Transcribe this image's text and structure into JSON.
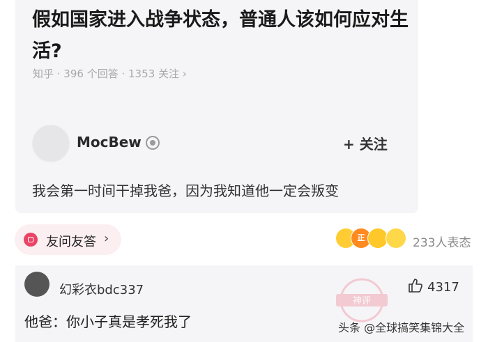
{
  "question": {
    "title": "假如国家进入战争状态，普通人该如何应对生活?",
    "meta": "知乎 · 396 个回答 · 1353 关注 ›"
  },
  "answer": {
    "username": "MocBew",
    "follow_label": "+ 关注",
    "text": "我会第一时间干掉我爸，因为我知道他一定会叛变"
  },
  "ask_friend": {
    "label": "友问友答",
    "chevron": "›"
  },
  "reactions": {
    "count_label": "233人表态",
    "emoji_badge": "正"
  },
  "comment": {
    "username": "幻彩衣bdc337",
    "likes": "4317",
    "text": "他爸：你小子真是孝死我了"
  },
  "watermark": {
    "seal_text": "神评",
    "source_text": "头条 @全球搞笑集锦大全"
  },
  "colors": {
    "accent_pink": "#e94465",
    "card_bg": "#f5f5f7"
  }
}
